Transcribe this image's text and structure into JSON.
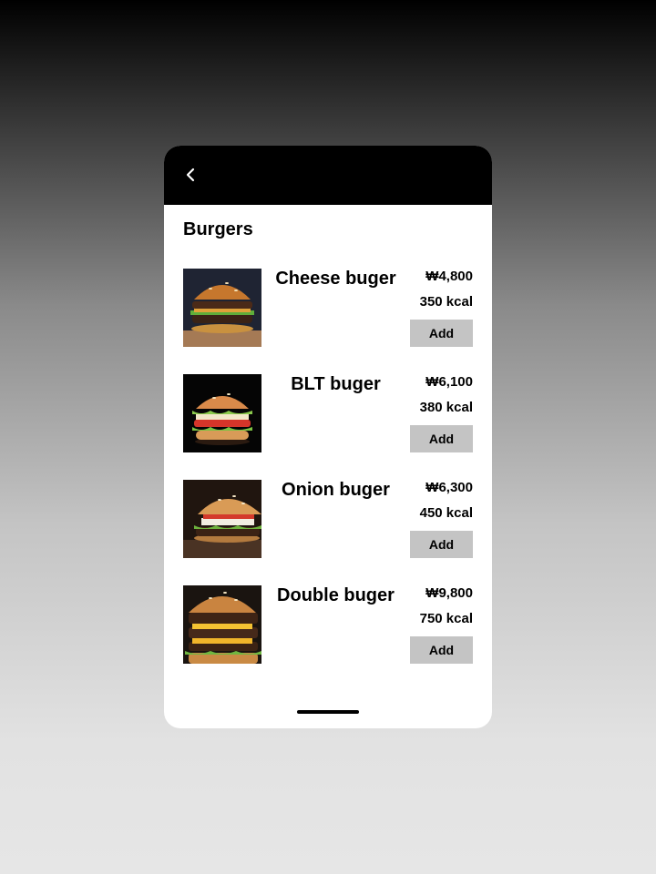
{
  "header": {
    "back_icon": "chevron-left-icon"
  },
  "section": {
    "title": "Burgers"
  },
  "items": [
    {
      "name": "Cheese buger",
      "price": "₩4,800",
      "kcal": "350 kcal",
      "add_label": "Add",
      "image": "cheese-burger-photo"
    },
    {
      "name": "BLT buger",
      "price": "₩6,100",
      "kcal": "380 kcal",
      "add_label": "Add",
      "image": "blt-burger-photo"
    },
    {
      "name": "Onion buger",
      "price": "₩6,300",
      "kcal": "450 kcal",
      "add_label": "Add",
      "image": "onion-burger-photo"
    },
    {
      "name": "Double buger",
      "price": "₩9,800",
      "kcal": "750 kcal",
      "add_label": "Add",
      "image": "double-burger-photo"
    }
  ],
  "colors": {
    "header_bg": "#000000",
    "card_bg": "#ffffff",
    "button_bg": "#c4c4c4"
  }
}
